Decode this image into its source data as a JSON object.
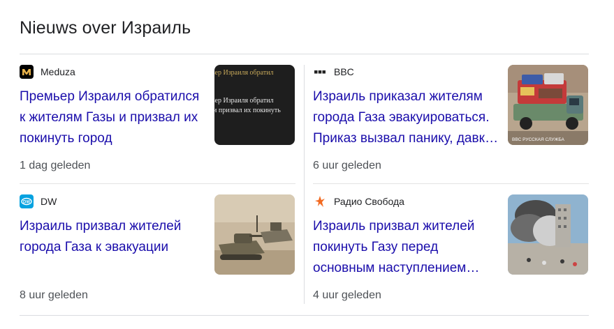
{
  "section_title": "Nieuws over Израиль",
  "articles": [
    {
      "source": "Meduza",
      "icon": "meduza-logo-icon",
      "headline": "Премьер Израиля обратился к жителям Газы и призвал их покинуть город",
      "time": "1 dag geleden",
      "thumb_text": [
        "ьер Израиля обратил",
        "и призвал их покинуть"
      ]
    },
    {
      "source": "BBC",
      "icon": "bbc-logo-icon",
      "headline": "Израиль приказал жителям города Газа эвакуироваться. Приказ вызвал панику, давку и пробки",
      "time": "6 uur geleden",
      "thumb_text": [
        "BBC РУССКАЯ СЛУЖБА"
      ]
    },
    {
      "source": "DW",
      "icon": "dw-logo-icon",
      "headline": "Израиль призвал жителей города Газа к эвакуации",
      "time": "8 uur geleden"
    },
    {
      "source": "Радио Свобода",
      "icon": "radio-svoboda-logo-icon",
      "headline": "Израиль призвал жителей покинуть Газу перед основным наступлением армии",
      "time": "4 uur geleden"
    }
  ],
  "colors": {
    "headline": "#1a0dab",
    "source": "#202124",
    "time": "#4d5156",
    "divider": "#dadce0"
  }
}
